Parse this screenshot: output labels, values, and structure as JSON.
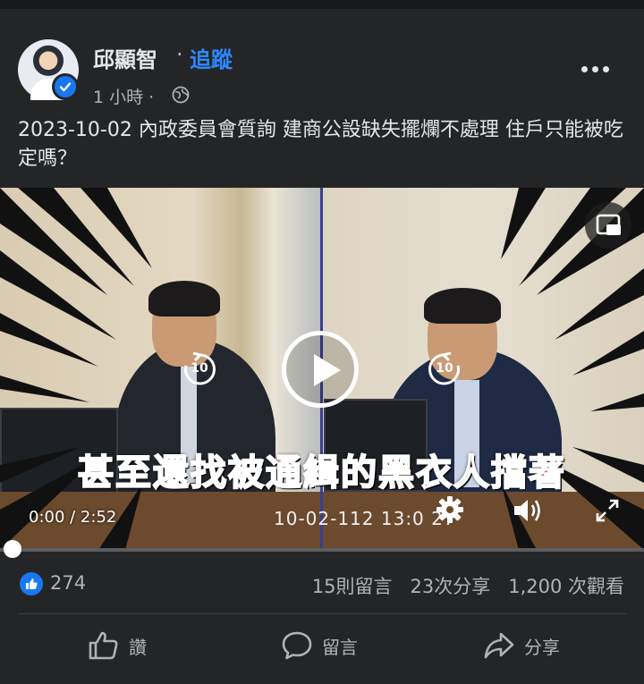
{
  "post": {
    "author": "邱顯智",
    "separator": "·",
    "follow_label": "追蹤",
    "time": "1 小時 ·",
    "caption": "2023-10-02 內政委員會質詢 建商公設缺失擺爛不處理 住戶只能被吃定嗎？",
    "icons": {
      "verified": "verified-badge-icon",
      "audience": "globe-icon",
      "more": "more-options-icon"
    }
  },
  "video": {
    "subtitle_red": "甚至還找被通緝的",
    "subtitle_black": "黑衣人",
    "subtitle_red2": "擋著",
    "current_time": "0:00 / 2:52",
    "timestamp_overlay": "10-02-112 13:0  27",
    "skip_back": "10",
    "skip_forward": "10",
    "progress": 0.0,
    "icons": [
      "pip-icon",
      "play-icon",
      "rewind-10-icon",
      "forward-10-icon",
      "settings-gear-icon",
      "volume-icon",
      "fullscreen-icon"
    ]
  },
  "stats": {
    "like_count": "274",
    "comments": "15則留言",
    "shares": "23次分享",
    "views": "1,200 次觀看"
  },
  "actions": {
    "like": "讚",
    "comment": "留言",
    "share": "分享"
  },
  "colors": {
    "background": "#242526",
    "accent": "#2d88ff",
    "like_blue": "#1877f2",
    "subtitle_red": "#e8312a"
  }
}
